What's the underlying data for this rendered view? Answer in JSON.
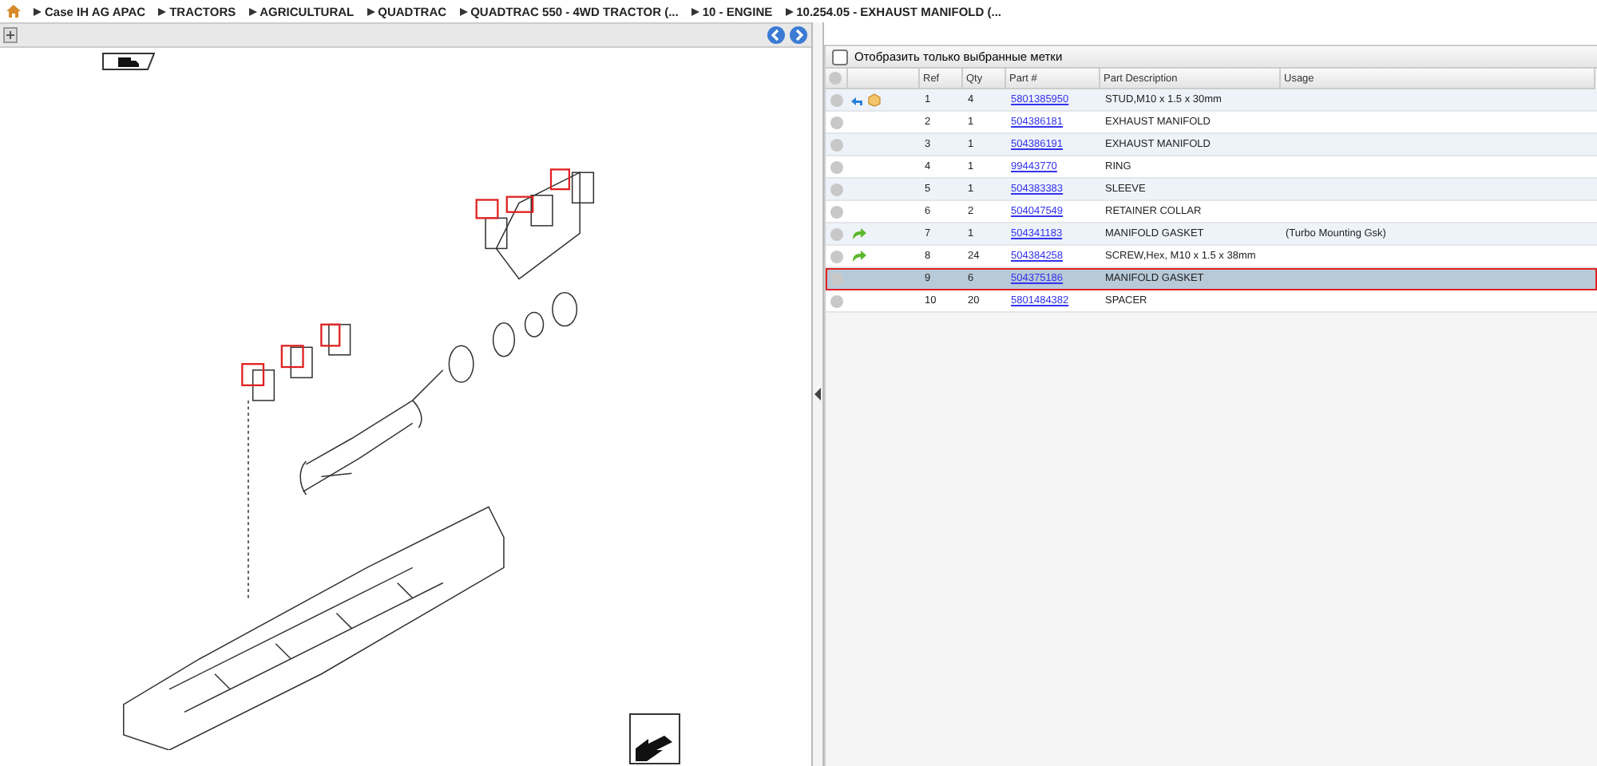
{
  "breadcrumb": [
    "Case IH AG APAC",
    "TRACTORS",
    "AGRICULTURAL",
    "QUADTRAC",
    "QUADTRAC 550 - 4WD TRACTOR (...",
    "10 - ENGINE",
    "10.254.05 - EXHAUST MANIFOLD (..."
  ],
  "filter": {
    "label": "Отобразить только выбранные метки",
    "checked": false
  },
  "table": {
    "columns": [
      "Ref",
      "Qty",
      "Part #",
      "Part Description",
      "Usage"
    ],
    "rows": [
      {
        "ref": "1",
        "qty": "4",
        "part": "5801385950",
        "description": "STUD,M10 x 1.5 x 30mm",
        "usage": "",
        "markers": [
          {
            "kind": "return"
          },
          {
            "kind": "package"
          }
        ],
        "selected": false
      },
      {
        "ref": "2",
        "qty": "1",
        "part": "504386181",
        "description": "EXHAUST MANIFOLD",
        "usage": "",
        "markers": [],
        "selected": false
      },
      {
        "ref": "3",
        "qty": "1",
        "part": "504386191",
        "description": "EXHAUST MANIFOLD",
        "usage": "",
        "markers": [],
        "selected": false
      },
      {
        "ref": "4",
        "qty": "1",
        "part": "99443770",
        "description": "RING",
        "usage": "",
        "markers": [],
        "selected": false
      },
      {
        "ref": "5",
        "qty": "1",
        "part": "504383383",
        "description": "SLEEVE",
        "usage": "",
        "markers": [],
        "selected": false
      },
      {
        "ref": "6",
        "qty": "2",
        "part": "504047549",
        "description": "RETAINER COLLAR",
        "usage": "",
        "markers": [],
        "selected": false
      },
      {
        "ref": "7",
        "qty": "1",
        "part": "504341183",
        "description": "MANIFOLD GASKET",
        "usage": "(Turbo Mounting Gsk)",
        "markers": [
          {
            "kind": "forward"
          }
        ],
        "selected": false
      },
      {
        "ref": "8",
        "qty": "24",
        "part": "504384258",
        "description": "SCREW,Hex, M10 x 1.5 x 38mm",
        "usage": "",
        "markers": [
          {
            "kind": "forward"
          }
        ],
        "selected": false
      },
      {
        "ref": "9",
        "qty": "6",
        "part": "504375186",
        "description": "MANIFOLD GASKET",
        "usage": "",
        "markers": [],
        "selected": true
      },
      {
        "ref": "10",
        "qty": "20",
        "part": "5801484382",
        "description": "SPACER",
        "usage": "",
        "markers": [],
        "selected": false
      }
    ]
  }
}
